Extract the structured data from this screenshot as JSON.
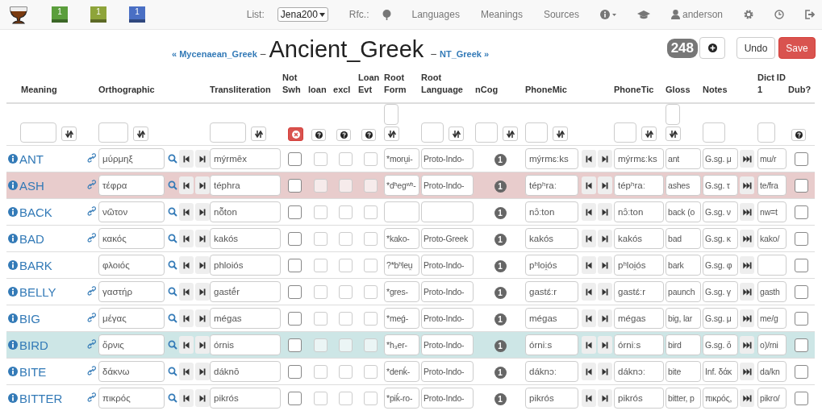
{
  "nav": {
    "lexicons": [
      {
        "label": "1",
        "color": "#5b9e3c"
      },
      {
        "label": "1",
        "color": "#8ea43a"
      },
      {
        "label": "1",
        "color": "#4a6fc4"
      }
    ],
    "list_label": "List:",
    "list_value": "Jena200",
    "rfc_label": "Rfc.:",
    "links": [
      "Languages",
      "Meanings",
      "Sources"
    ],
    "user": "anderson"
  },
  "title": {
    "prev": "« Mycenaean_Greek",
    "dash_left": "–",
    "language": "Ancient_Greek",
    "dash_right": "–",
    "next": "NT_Greek »",
    "count": "248",
    "undo": "Undo",
    "save": "Save"
  },
  "columns": [
    "Meaning",
    "Orthographic",
    "Transliteration",
    "Not Swh",
    "loan",
    "excl",
    "Loan Evt",
    "Root Form",
    "Root Language",
    "nCog",
    "PhoneMic",
    "PhoneTic",
    "Gloss",
    "Notes",
    "Dict ID 1",
    "Dub?"
  ],
  "rows": [
    {
      "meaning": "ANT",
      "linked": true,
      "orthographic": "μύρμηξ",
      "transliteration": "mýrmēx",
      "not_swh": false,
      "loan": false,
      "excl": false,
      "loan_evt": false,
      "root_form": "*moru̯i-",
      "root_language": "Proto-Indo-",
      "n_cog": "1",
      "phonemic": "mýrmɛːks",
      "phonetic": "mýrmɛːks",
      "gloss": "ant",
      "notes": "G.sg. μ",
      "dict_id": "mu/r",
      "dub": false,
      "color": "#ffffff"
    },
    {
      "meaning": "ASH",
      "linked": true,
      "orthographic": "τέφρα",
      "transliteration": "téphra",
      "not_swh": false,
      "loan": false,
      "excl": false,
      "loan_evt": false,
      "root_form": "*dʰegʷʰ-",
      "root_language": "Proto-Indo-",
      "n_cog": "1",
      "phonemic": "tépʰraː",
      "phonetic": "tépʰraː",
      "gloss": "ashes",
      "notes": "G.sg. τ",
      "dict_id": "te/fra",
      "dub": false,
      "color": "#e8cccc"
    },
    {
      "meaning": "BACK",
      "linked": true,
      "orthographic": "νῶτον",
      "transliteration": "nō̃ton",
      "not_swh": false,
      "loan": false,
      "excl": false,
      "loan_evt": false,
      "n_cog": "1",
      "phonemic": "nɔ̂ːton",
      "phonetic": "nɔ̂ːton",
      "gloss": "back (o",
      "notes": "G.sg. ν",
      "dict_id": "nw=t",
      "dub": false,
      "color": "#ffffff"
    },
    {
      "meaning": "BAD",
      "linked": true,
      "orthographic": "κακός",
      "transliteration": "kakós",
      "not_swh": false,
      "loan": false,
      "excl": false,
      "loan_evt": false,
      "root_form": "*kako-",
      "root_language": "Proto-Greek",
      "n_cog": "1",
      "phonemic": "kakós",
      "phonetic": "kakós",
      "gloss": "bad",
      "notes": "G.sg. κ",
      "dict_id": "kako/",
      "dub": false,
      "color": "#ffffff"
    },
    {
      "meaning": "BARK",
      "linked": false,
      "orthographic": "φλοιός",
      "transliteration": "phloiós",
      "not_swh": false,
      "loan": false,
      "excl": false,
      "loan_evt": false,
      "root_form": "?*bʰleu̯",
      "root_language": "Proto-Indo-",
      "n_cog": "1",
      "phonemic": "pʰloi̯ós",
      "phonetic": "pʰloi̯ós",
      "gloss": "bark",
      "notes": "G.sg. φ",
      "dub": false,
      "color": "#ffffff"
    },
    {
      "meaning": "BELLY",
      "linked": true,
      "orthographic": "γαστήρ",
      "transliteration": "gastḗr",
      "not_swh": false,
      "loan": false,
      "excl": false,
      "loan_evt": false,
      "root_form": "*gres-",
      "root_language": "Proto-Indo-",
      "n_cog": "1",
      "phonemic": "gastɛ́ːr",
      "phonetic": "gastɛ́ːr",
      "gloss": "paunch",
      "notes": "G.sg. γ",
      "dict_id": "gasth",
      "dub": false,
      "color": "#ffffff"
    },
    {
      "meaning": "BIG",
      "linked": true,
      "orthographic": "μέγας",
      "transliteration": "mégas",
      "not_swh": false,
      "loan": false,
      "excl": false,
      "loan_evt": false,
      "root_form": "*meǵ-",
      "root_language": "Proto-Indo-",
      "n_cog": "1",
      "phonemic": "mégas",
      "phonetic": "mégas",
      "gloss": "big, lar",
      "notes": "G.sg. μ",
      "dict_id": "me/g",
      "dub": false,
      "color": "#ffffff"
    },
    {
      "meaning": "BIRD",
      "linked": true,
      "orthographic": "ὄρνις",
      "transliteration": "órnis",
      "not_swh": false,
      "loan": false,
      "excl": false,
      "loan_evt": false,
      "root_form": "*h₃er-",
      "root_language": "Proto-Indo-",
      "n_cog": "1",
      "phonemic": "órniːs",
      "phonetic": "órniːs",
      "gloss": "bird",
      "notes": "G.sg. ὄ",
      "dict_id": "o)/rni",
      "dub": false,
      "color": "#cde6e6"
    },
    {
      "meaning": "BITE",
      "linked": true,
      "orthographic": "δάκνω",
      "transliteration": "dáknō",
      "not_swh": false,
      "loan": false,
      "excl": false,
      "loan_evt": false,
      "root_form": "*denḱ-",
      "root_language": "Proto-Indo-",
      "n_cog": "1",
      "phonemic": "dáknɔː",
      "phonetic": "dáknɔː",
      "gloss": "bite",
      "notes": "Inf. δάκ",
      "dict_id": "da/kn",
      "dub": false,
      "color": "#ffffff"
    },
    {
      "meaning": "BITTER",
      "linked": true,
      "orthographic": "πικρός",
      "transliteration": "pikrós",
      "not_swh": false,
      "loan": false,
      "excl": false,
      "loan_evt": false,
      "root_form": "*piḱ-ro-",
      "root_language": "Proto-Indo-",
      "n_cog": "1",
      "phonemic": "pikrós",
      "phonetic": "pikrós",
      "gloss": "bitter, p",
      "notes": "πικρός,",
      "dict_id": "pikro/",
      "dub": false,
      "color": "#ffffff"
    }
  ]
}
